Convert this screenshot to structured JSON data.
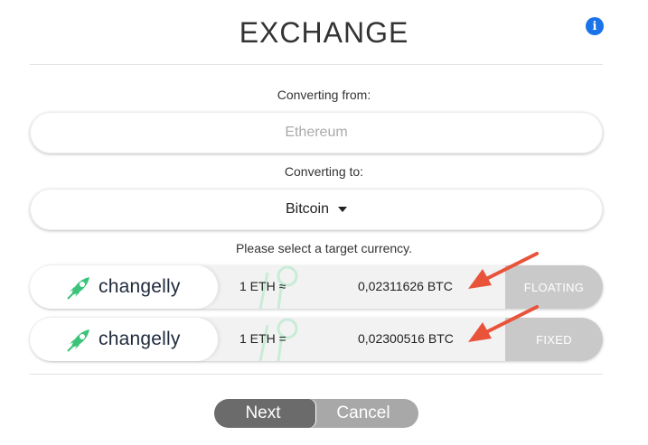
{
  "header": {
    "title": "EXCHANGE",
    "info_icon": "info-icon"
  },
  "from": {
    "label": "Converting from:",
    "placeholder": "Ethereum"
  },
  "to": {
    "label": "Converting to:",
    "value": "Bitcoin",
    "hint": "Please select a target currency."
  },
  "rates": [
    {
      "provider": "changelly",
      "pair": "1 ETH ≈",
      "rate": "0,02311626 BTC",
      "mode": "FLOATING"
    },
    {
      "provider": "changelly",
      "pair": "1 ETH =",
      "rate": "0,02300516 BTC",
      "mode": "FIXED"
    }
  ],
  "buttons": {
    "next": "Next",
    "cancel": "Cancel"
  },
  "colors": {
    "accent": "#1a73e8",
    "logo_green": "#3cc37a",
    "arrow": "#e8533a",
    "mode_bg": "#c9c9c9"
  }
}
